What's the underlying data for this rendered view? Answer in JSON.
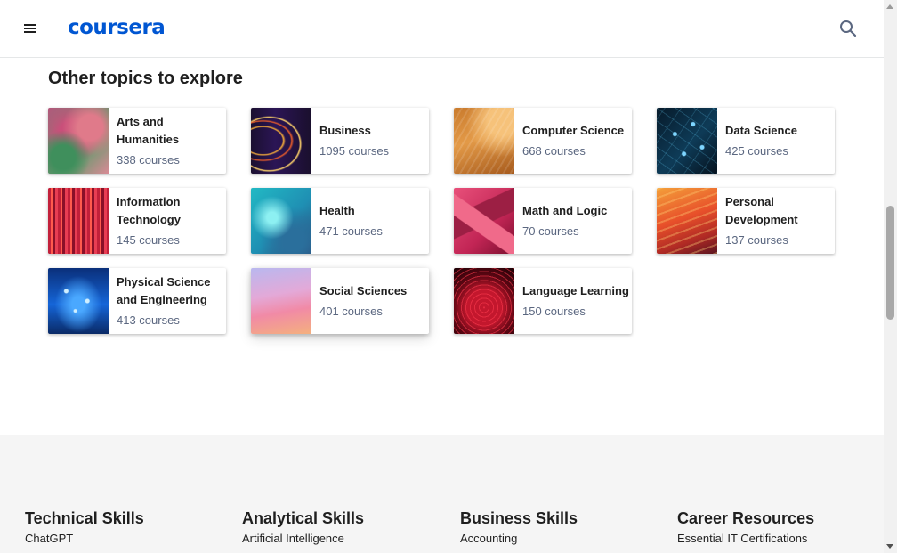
{
  "header": {
    "logo_text": "coursera",
    "menu_icon": "hamburger-menu-icon",
    "search_icon": "search-icon",
    "brand_color": "#0056d2"
  },
  "topics": {
    "title": "Other topics to explore",
    "cards": [
      {
        "title": "Arts and Humanities",
        "count": "338 courses"
      },
      {
        "title": "Business",
        "count": "1095 courses"
      },
      {
        "title": "Computer Science",
        "count": "668 courses"
      },
      {
        "title": "Data Science",
        "count": "425 courses"
      },
      {
        "title": "Information Technology",
        "count": "145 courses"
      },
      {
        "title": "Health",
        "count": "471 courses"
      },
      {
        "title": "Math and Logic",
        "count": "70 courses"
      },
      {
        "title": "Personal Development",
        "count": "137 courses"
      },
      {
        "title": "Physical Science and Engineering",
        "count": "413 courses"
      },
      {
        "title": "Social Sciences",
        "count": "401 courses"
      },
      {
        "title": "Language Learning",
        "count": "150 courses"
      }
    ]
  },
  "footer": {
    "columns": [
      {
        "heading": "Technical Skills",
        "links": [
          "ChatGPT"
        ]
      },
      {
        "heading": "Analytical Skills",
        "links": [
          "Artificial Intelligence"
        ]
      },
      {
        "heading": "Business Skills",
        "links": [
          "Accounting"
        ]
      },
      {
        "heading": "Career Resources",
        "links": [
          "Essential IT Certifications"
        ]
      }
    ]
  }
}
